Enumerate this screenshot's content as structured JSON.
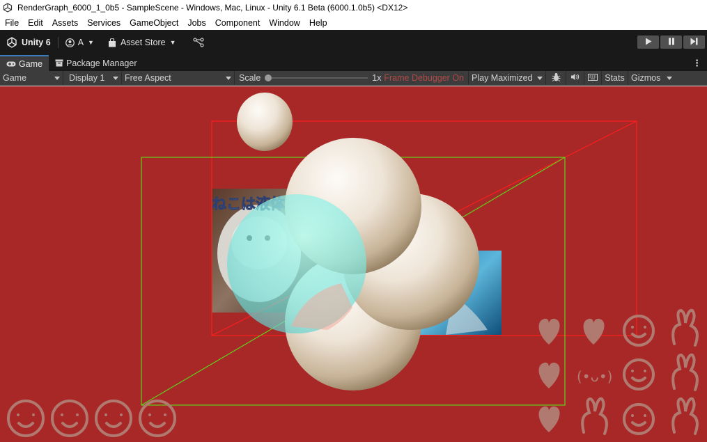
{
  "window": {
    "title": "RenderGraph_6000_1_0b5 - SampleScene - Windows, Mac, Linux - Unity 6.1 Beta (6000.1.0b5) <DX12>"
  },
  "menu": [
    "File",
    "Edit",
    "Assets",
    "Services",
    "GameObject",
    "Jobs",
    "Component",
    "Window",
    "Help"
  ],
  "toolbar": {
    "brand": "Unity 6",
    "account": "A",
    "asset_store": "Asset Store",
    "play_icon": "play-icon",
    "pause_icon": "pause-icon",
    "step_icon": "step-icon"
  },
  "tabs": [
    {
      "label": "Game",
      "icon": "gamepad-icon",
      "active": true
    },
    {
      "label": "Package Manager",
      "icon": "package-icon",
      "active": false
    }
  ],
  "tabs_more": "⋮",
  "game_toolbar": {
    "view": "Game",
    "display": "Display 1",
    "aspect": "Free Aspect",
    "scale_label": "Scale",
    "scale_value": "1x",
    "scale_fraction": 0.0,
    "frame_debugger": "Frame Debugger On",
    "play_mode": "Play Maximized",
    "stats": "Stats",
    "gizmos": "Gizmos"
  },
  "scene": {
    "background_color": "#a82828",
    "image_text": "ねこは液体",
    "stickers": [
      "heart",
      "heart",
      "smile",
      "bunny",
      "heart",
      "kaomoji",
      "smile",
      "bunny",
      "heart",
      "bunny",
      "smile",
      "bunny"
    ],
    "kaomoji": "(•ᴗ•)"
  }
}
